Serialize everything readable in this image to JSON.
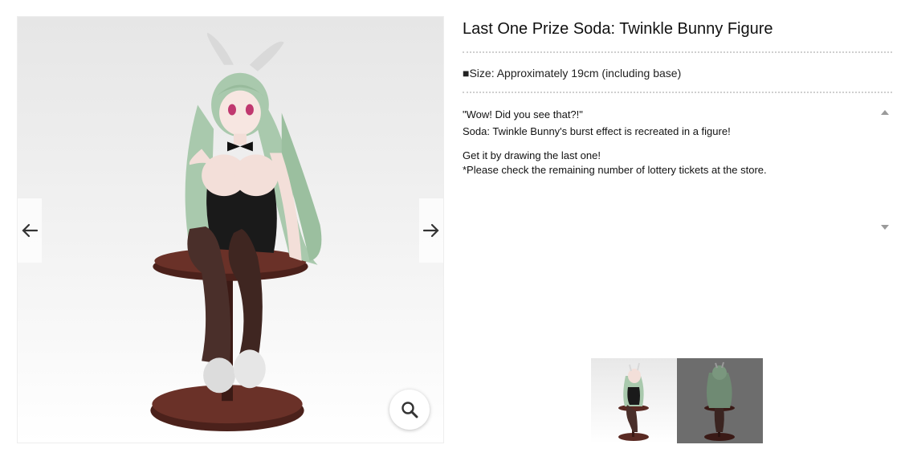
{
  "product": {
    "title": "Last One Prize Soda: Twinkle Bunny Figure",
    "size": "■Size: Approximately 19cm (including base)",
    "description": {
      "line1": "\"Wow! Did you see that?!\"",
      "line2": "Soda: Twinkle Bunny's burst effect is recreated in a figure!",
      "line3": "Get it by drawing the last one!",
      "line4": "*Please check the remaining number of lottery tickets at the store."
    }
  },
  "gallery": {
    "main_image": "figure-product-photo",
    "prev_icon": "arrow-left-icon",
    "next_icon": "arrow-right-icon",
    "zoom_icon": "magnifier-icon"
  },
  "thumbnails": [
    {
      "name": "front-view"
    },
    {
      "name": "back-view"
    }
  ],
  "colors": {
    "hair": "#a9c9ad",
    "stocking": "#4a2f2a",
    "base": "#5a2a23",
    "suit": "#1a1a1a"
  }
}
